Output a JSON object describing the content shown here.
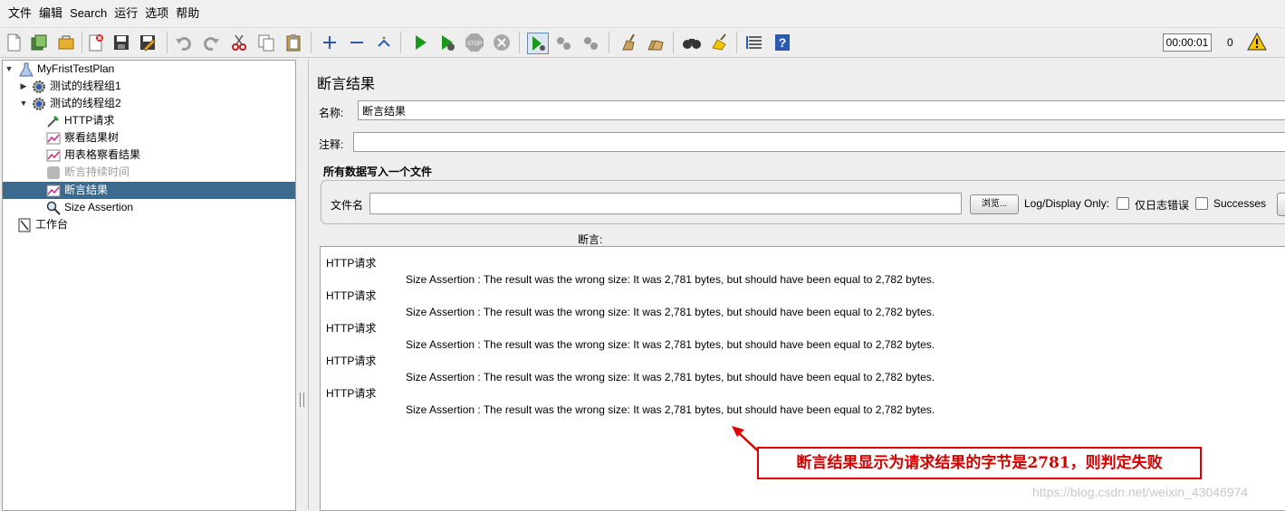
{
  "menu": [
    "文件",
    "编辑",
    "Search",
    "运行",
    "选项",
    "帮助"
  ],
  "toolbar": {
    "icons": [
      "new-icon",
      "templates-icon",
      "open-icon",
      "close-icon",
      "save-icon",
      "save-as-icon",
      "undo-icon",
      "redo-icon",
      "cut-icon",
      "copy-icon",
      "paste-icon",
      "expand-icon",
      "collapse-icon",
      "toggle-icon",
      "start-icon",
      "start-no-pause-icon",
      "stop-icon",
      "shutdown-icon",
      "remote-start-icon",
      "remote-stop-icon",
      "remote-shutdown-icon",
      "clear-icon",
      "clear-all-icon",
      "search-icon",
      "reset-search-icon",
      "function-helper-icon",
      "help-icon"
    ],
    "timer": "00:00:01",
    "error_count": "0"
  },
  "tree": {
    "items": [
      {
        "label": "MyFristTestPlan",
        "icon": "test-plan-icon",
        "level": 0,
        "toggle": "▼"
      },
      {
        "label": "测试的线程组1",
        "icon": "thread-group-icon",
        "level": 1,
        "toggle": "▶"
      },
      {
        "label": "测试的线程组2",
        "icon": "thread-group-icon",
        "level": 1,
        "toggle": "▼"
      },
      {
        "label": "HTTP请求",
        "icon": "http-sampler-icon",
        "level": 2
      },
      {
        "label": "察看结果树",
        "icon": "listener-icon",
        "level": 2
      },
      {
        "label": "用表格察看结果",
        "icon": "listener-icon",
        "level": 2
      },
      {
        "label": "断言持续时间",
        "icon": "disabled-listener-icon",
        "level": 2,
        "disabled": true
      },
      {
        "label": "断言结果",
        "icon": "listener-icon",
        "level": 2,
        "selected": true
      },
      {
        "label": "Size Assertion",
        "icon": "assertion-icon",
        "level": 2
      },
      {
        "label": "工作台",
        "icon": "workbench-icon",
        "level": 0
      }
    ]
  },
  "panel": {
    "title": "断言结果",
    "name_label": "名称:",
    "name_value": "断言结果",
    "comment_label": "注释:",
    "comment_value": "",
    "file_section_title": "所有数据写入一个文件",
    "filename_label": "文件名",
    "filename_value": "",
    "browse_button": "浏览...",
    "log_display_only": "Log/Display Only:",
    "errors_only": "仅日志错误",
    "successes": "Successes",
    "assertions_header": "断言:"
  },
  "results": [
    {
      "sampler": "HTTP请求",
      "message": "Size Assertion : The result was the wrong size: It was 2,781 bytes, but should have been equal to 2,782 bytes."
    },
    {
      "sampler": "HTTP请求",
      "message": "Size Assertion : The result was the wrong size: It was 2,781 bytes, but should have been equal to 2,782 bytes."
    },
    {
      "sampler": "HTTP请求",
      "message": "Size Assertion : The result was the wrong size: It was 2,781 bytes, but should have been equal to 2,782 bytes."
    },
    {
      "sampler": "HTTP请求",
      "message": "Size Assertion : The result was the wrong size: It was 2,781 bytes, but should have been equal to 2,782 bytes."
    },
    {
      "sampler": "HTTP请求",
      "message": "Size Assertion : The result was the wrong size: It was 2,781 bytes, but should have been equal to 2,782 bytes."
    }
  ],
  "annotation": {
    "text": "断言结果显示为请求结果的字节是2781，则判定失败",
    "color": "#e00000"
  },
  "watermark": "https://blog.csdn.net/weixin_43046974",
  "colors": {
    "selection": "#3c6a8e",
    "start_green": "#1a9a1a",
    "warning_yellow": "#f4c400"
  }
}
